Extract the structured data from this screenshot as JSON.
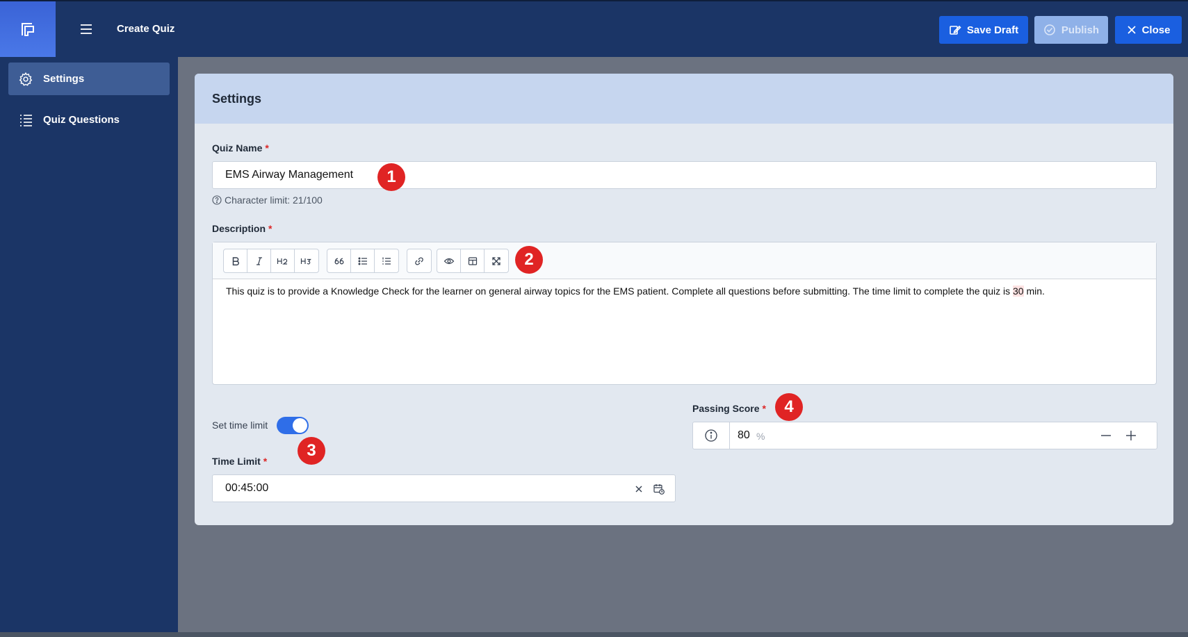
{
  "header": {
    "page_title": "Create Quiz",
    "save_draft_label": "Save Draft",
    "publish_label": "Publish",
    "close_label": "Close"
  },
  "sidebar": {
    "items": [
      {
        "label": "Settings",
        "icon": "gear-icon",
        "active": true
      },
      {
        "label": "Quiz Questions",
        "icon": "list-icon",
        "active": false
      }
    ]
  },
  "settings": {
    "title": "Settings",
    "quiz_name": {
      "label": "Quiz Name",
      "required": "*",
      "value": "EMS Airway Management",
      "hint": "Character limit: 21/100"
    },
    "description": {
      "label": "Description",
      "required": "*",
      "toolbar": [
        "B",
        "I",
        "H2",
        "H3",
        "66",
        "bullet-list",
        "numbered-list",
        "link",
        "preview",
        "table",
        "fullscreen"
      ],
      "text_before": "This quiz is to provide a Knowledge Check for the learner on general airway topics for the EMS patient. Complete all questions before submitting. The time limit to complete the quiz is ",
      "text_highlight": "30",
      "text_after": " min."
    },
    "time_limit_toggle": {
      "label": "Set time limit",
      "on": true
    },
    "time_limit": {
      "label": "Time Limit",
      "required": "*",
      "value": "00:45:00"
    },
    "passing_score": {
      "label": "Passing Score",
      "required": "*",
      "value": "80",
      "unit": "%"
    }
  },
  "annotations": [
    "1",
    "2",
    "3",
    "4"
  ],
  "colors": {
    "header_bg": "#1b3566",
    "primary": "#1a5fe0",
    "badge": "#e02424"
  }
}
